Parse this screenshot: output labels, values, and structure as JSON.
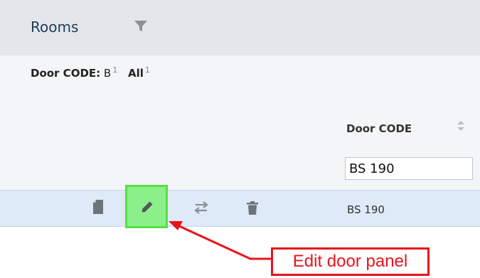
{
  "header": {
    "title": "Rooms",
    "filter_icon": "funnel-icon"
  },
  "filter_summary": {
    "label": "Door CODE:",
    "value": "B",
    "value_count": "1",
    "all_label": "All",
    "all_count": "1"
  },
  "table": {
    "column": {
      "label": "Door CODE",
      "sort_icon": "sort-icon"
    },
    "column_filter_value": "BS 190",
    "rows": [
      {
        "door_code": "BS 190",
        "actions": [
          "document-icon",
          "pencil-icon",
          "swap-arrows-icon",
          "trash-icon"
        ]
      }
    ]
  },
  "annotation": {
    "callout_text": "Edit door panel",
    "color": "#e8141c",
    "highlight_color": "#8cf08a"
  }
}
